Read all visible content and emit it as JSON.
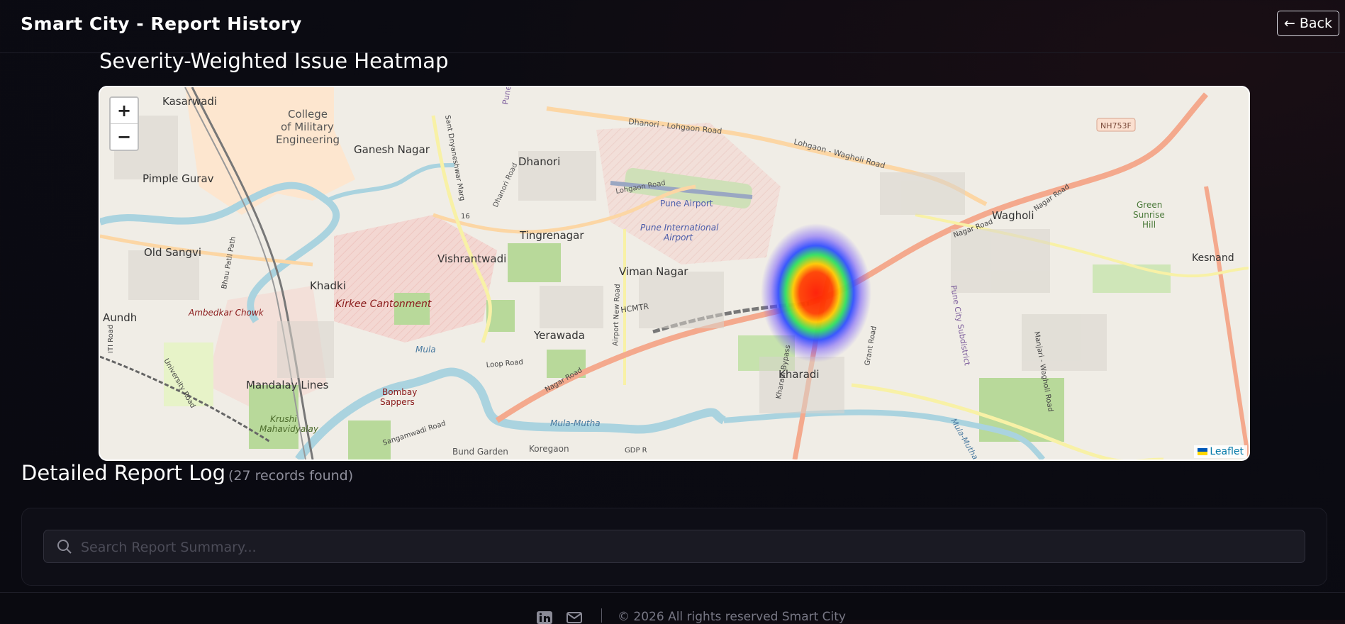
{
  "header": {
    "title": "Smart City - Report History",
    "back_label": "← Back"
  },
  "map": {
    "heading": "Severity-Weighted Issue Heatmap",
    "zoom_in": "+",
    "zoom_out": "−",
    "attribution": "Leaflet",
    "labels": {
      "kasarwadi": "Kasarwadi",
      "college1": "College",
      "college2": "of Military",
      "college3": "Engineering",
      "ganesh_nagar": "Ganesh Nagar",
      "dhanori": "Dhanori",
      "dhanori_lohgaon_road": "Dhanori - Lohgaon Road",
      "lohgaon_wagholi_road": "Lohgaon - Wagholi Road",
      "nh753f": "NH753F",
      "pimple_gurav": "Pimple Gurav",
      "pune_airport": "Pune Airport",
      "pune_intl_1": "Pune International",
      "pune_intl_2": "Airport",
      "lohgaon_road": "Lohgaon Road",
      "dhanori_road": "Dhanori Road",
      "tingrenagar": "Tingrenagar",
      "old_sangvi": "Old Sangvi",
      "vishrantwadi": "Vishrantwadi",
      "wagholi": "Wagholi",
      "green1": "Green",
      "green2": "Sunrise",
      "green3": "Hill",
      "kesnand": "Kesnand",
      "nagar_road_1": "Nagar Road",
      "nagar_road_2": "Nagar Road",
      "viman_nagar": "Viman Nagar",
      "khadki": "Khadki",
      "kirkee": "Kirkee Cantonment",
      "ambedkar": "Ambedkar Chowk",
      "aundh": "Aundh",
      "hcmtr": "HCMTR",
      "yerawada": "Yerawada",
      "airport_new_road": "Airport New Road",
      "kharadi": "Kharadi",
      "kharadi_bypass": "Kharadi Bypass",
      "grant_road": "Grant Road",
      "pune_city_subdistrict": "Pune City Subdistrict",
      "manjari_road": "Manjari - Wagholi Road",
      "loop_road": "Loop Road",
      "nagar_road_3": "Nagar Road",
      "mula": "Mula",
      "mandalay": "Mandalay Lines",
      "bombay1": "Bombay",
      "bombay2": "Sappers",
      "university_road": "University Road",
      "sangamwadi_road": "Sangamwadi Road",
      "mula_mutha": "Mula-Mutha",
      "mula_mutha_2": "Mula-Mutha",
      "krushi1": "Krushi",
      "krushi2": "Mahavidyalay",
      "bund_garden": "Bund Garden",
      "koregaon": "Koregaon",
      "gdp": "GDP R",
      "pune_city_label": "Pune City Su",
      "bhau_patil": "Bhau Patil Path",
      "sant_dnyaneshwar": "Sant Dnyaneshwar Marg",
      "road_16": "16",
      "iti_road": "ITI Road"
    }
  },
  "log": {
    "heading": "Detailed Report Log",
    "count": "(27 records found)",
    "search_placeholder": "Search Report Summary..."
  },
  "footer": {
    "copyright": "© 2026 All rights reserved Smart City"
  }
}
